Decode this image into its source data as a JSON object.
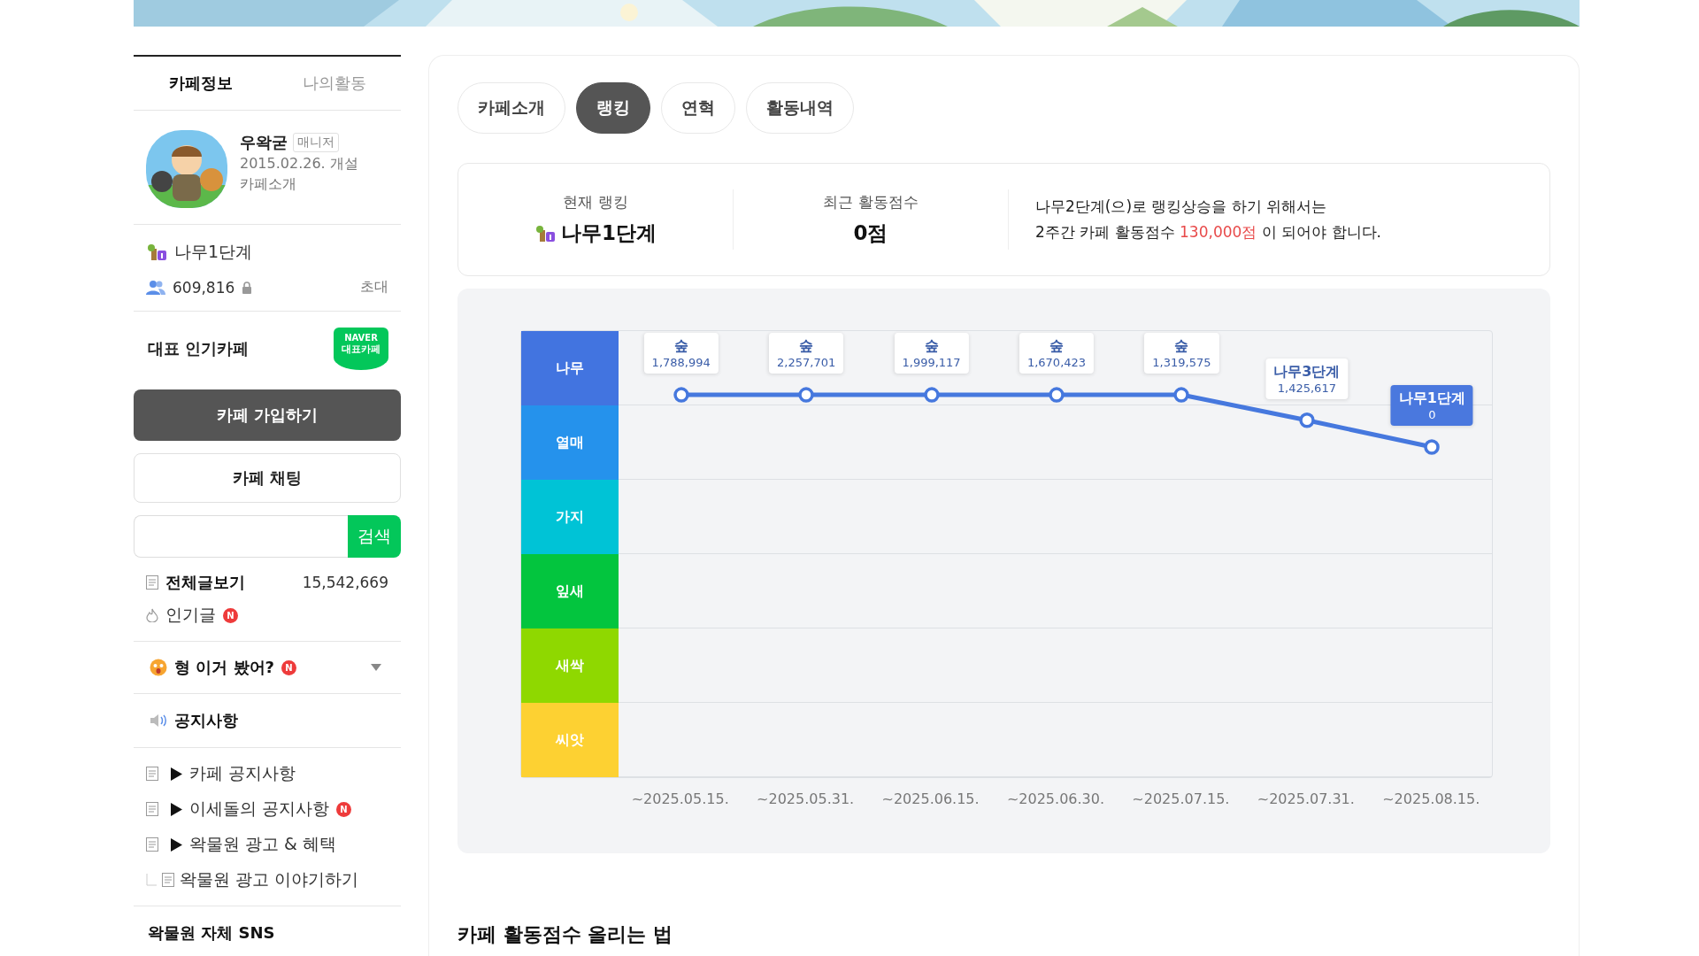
{
  "sidebar": {
    "tabs": [
      {
        "label": "카페정보",
        "selected": true
      },
      {
        "label": "나의활동",
        "selected": false
      }
    ],
    "profile": {
      "name": "우왁굳",
      "role": "매니저",
      "founded": "2015.02.26. 개설",
      "intro_link": "카페소개"
    },
    "rank": "나무1단계",
    "members": "609,816",
    "invite": "초대",
    "featured": {
      "label": "대표 인기카페",
      "badge_top": "NAVER",
      "badge_bottom": "대표카페"
    },
    "join_button": "카페 가입하기",
    "chat_button": "카페 채팅",
    "search": {
      "button": "검색"
    },
    "all_posts": {
      "label": "전체글보기",
      "count": "15,542,669"
    },
    "popular": {
      "label": "인기글",
      "badge": "N"
    },
    "category_toggle": {
      "label": "형 이거 봤어?",
      "badge": "N",
      "expanded": false
    },
    "notice_header": "공지사항",
    "boards": [
      {
        "label": "카페 공지사항"
      },
      {
        "label": "이세돌의 공지사항",
        "badge": "N"
      },
      {
        "label": "왁물원 광고 & 혜택",
        "children": [
          {
            "label": "왁물원 광고 이야기하기"
          }
        ]
      }
    ],
    "sns_heading": "왁물원 자체 SNS"
  },
  "main": {
    "tabs": [
      {
        "label": "카페소개",
        "selected": false
      },
      {
        "label": "랭킹",
        "selected": true
      },
      {
        "label": "연혁",
        "selected": false
      },
      {
        "label": "활동내역",
        "selected": false
      }
    ],
    "ranking_summary": {
      "current_label": "현재 랭킹",
      "current_value": "나무1단계",
      "score_label": "최근 활동점수",
      "score_value": "0점",
      "goal_line1": "나무2단계(으)로 랭킹상승을 하기 위해서는",
      "goal_before": "2주간 카페 활동점수 ",
      "goal_highlight": "130,000점",
      "goal_after": " 이 되어야 합니다."
    },
    "ranking_chart": {
      "levels": [
        {
          "name": "나무",
          "color": "#4274e0"
        },
        {
          "name": "열매",
          "color": "#2592ec"
        },
        {
          "name": "가지",
          "color": "#00c3d6"
        },
        {
          "name": "잎새",
          "color": "#03c53e"
        },
        {
          "name": "새싹",
          "color": "#8fd800"
        },
        {
          "name": "씨앗",
          "color": "#fdd132"
        }
      ],
      "points": [
        {
          "date": "~2025.05.15.",
          "rank": "숲",
          "score": "1,788,994",
          "level": 0.857,
          "selected": false
        },
        {
          "date": "~2025.05.31.",
          "rank": "숲",
          "score": "2,257,701",
          "level": 0.857,
          "selected": false
        },
        {
          "date": "~2025.06.15.",
          "rank": "숲",
          "score": "1,999,117",
          "level": 0.857,
          "selected": false
        },
        {
          "date": "~2025.06.30.",
          "rank": "숲",
          "score": "1,670,423",
          "level": 0.857,
          "selected": false
        },
        {
          "date": "~2025.07.15.",
          "rank": "숲",
          "score": "1,319,575",
          "level": 0.857,
          "selected": false
        },
        {
          "date": "~2025.07.31.",
          "rank": "나무3단계",
          "score": "1,425,617",
          "level": 0.8,
          "selected": false
        },
        {
          "date": "~2025.08.15.",
          "rank": "나무1단계",
          "score": "0",
          "level": 0.74,
          "selected": true
        }
      ]
    },
    "section_heading": "카페 활동점수 올리는 법"
  }
}
